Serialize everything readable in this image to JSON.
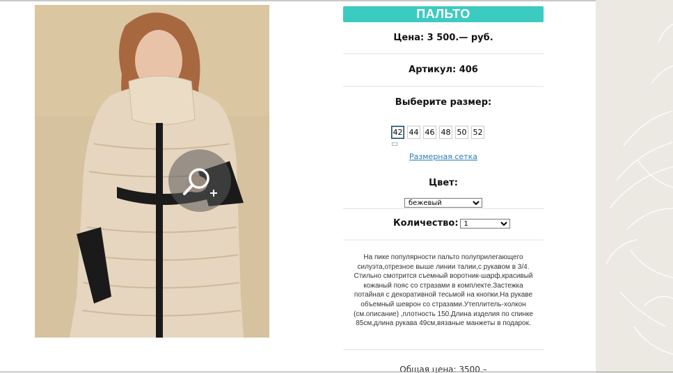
{
  "product": {
    "title": "ПАЛЬТО",
    "price": "Цена: 3 500.— руб.",
    "article": "Артикул: 406",
    "size_prompt": "Выберите размер:",
    "sizes": [
      "42",
      "44",
      "46",
      "48",
      "50",
      "52"
    ],
    "selected_size": "42",
    "size_chart_link": "Размерная сетка",
    "color_label": "Цвет:",
    "color_value": "бежевый",
    "quantity_label": "Количество:",
    "quantity_value": "1",
    "description": "На пике популярности пальто полуприлегающего силуэта,отрезное выше линии талии,с рукавом в 3/4. Стильно смотрится съемный воротник-шарф,красивый кожаный пояс со стразами в комплекте.Застежка потайная с декоративной тесьмой на кнопки.На рукаве объемный шеврон со стразами.Утеплитель-холкон (см.описание) ,плотность 150.Длина изделия по спинке 85см,длина рукава 49см,вязаные манжеты в подарок.",
    "total": "Общая цена: 3500.–"
  },
  "colors": {
    "accent": "#3ccbc1",
    "link": "#2a7ab8",
    "deco_panel": "#ece9e3"
  },
  "icons": {
    "zoom": "zoom-in-icon"
  }
}
